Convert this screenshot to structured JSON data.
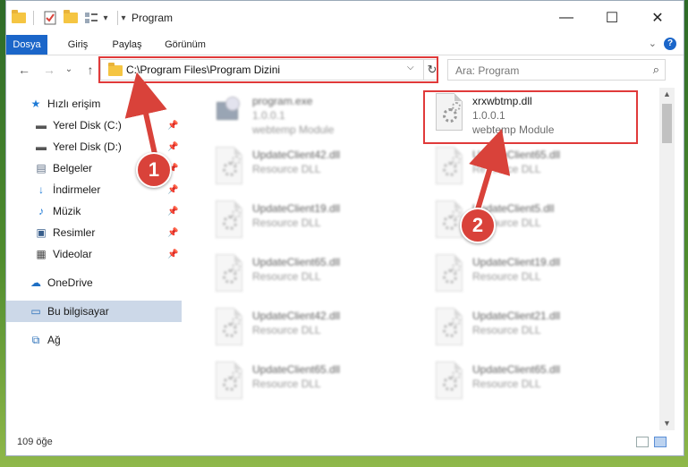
{
  "window": {
    "title": "Program",
    "controls": {
      "minimize": "—",
      "maximize": "☐",
      "close": "✕"
    }
  },
  "quick_access_toolbar": {
    "icons": [
      "folder-icon",
      "properties-checkmark-icon",
      "new-folder-icon",
      "view-options-icon",
      "dropdown-arrow-icon"
    ],
    "dropdown_glyph": "▾"
  },
  "ribbon": {
    "tabs": [
      {
        "label": "Dosya",
        "active": true
      },
      {
        "label": "Giriş"
      },
      {
        "label": "Paylaş"
      },
      {
        "label": "Görünüm"
      }
    ],
    "help": "?",
    "collapse": "⌄"
  },
  "navigation": {
    "back": "←",
    "forward": "→",
    "recent": "⌄",
    "up": "↑",
    "address": "C:\\Program Files\\Program Dizini",
    "address_dropdown": "⌵",
    "refresh": "↻",
    "search_placeholder": "Ara: Program",
    "search_icon": "⌕"
  },
  "sidebar": {
    "items": [
      {
        "label": "Hızlı erişim",
        "icon": "star-icon",
        "glyph": "★",
        "color": "#1e7ad6",
        "pinned": false
      },
      {
        "label": "Yerel Disk (C:)",
        "icon": "drive-icon",
        "glyph": "▬",
        "color": "#555555",
        "pinned": true
      },
      {
        "label": "Yerel Disk (D:)",
        "icon": "drive-icon",
        "glyph": "▬",
        "color": "#555555",
        "pinned": true
      },
      {
        "label": "Belgeler",
        "icon": "documents-icon",
        "glyph": "▤",
        "color": "#5a6b82",
        "pinned": true
      },
      {
        "label": "İndirmeler",
        "icon": "download-icon",
        "glyph": "↓",
        "color": "#1e7ad6",
        "pinned": true
      },
      {
        "label": "Müzik",
        "icon": "music-icon",
        "glyph": "♪",
        "color": "#1e7ad6",
        "pinned": true
      },
      {
        "label": "Resimler",
        "icon": "pictures-icon",
        "glyph": "▣",
        "color": "#3a5f8c",
        "pinned": true
      },
      {
        "label": "Videolar",
        "icon": "videos-icon",
        "glyph": "▦",
        "color": "#444444",
        "pinned": true
      },
      {
        "label": "OneDrive",
        "icon": "cloud-icon",
        "glyph": "☁",
        "color": "#1e6fc4",
        "pinned": false
      },
      {
        "label": "Bu bilgisayar",
        "icon": "computer-icon",
        "glyph": "▭",
        "color": "#2a6fb8",
        "pinned": false,
        "selected": true
      },
      {
        "label": "Ağ",
        "icon": "network-icon",
        "glyph": "⧉",
        "color": "#2a6fb8",
        "pinned": false
      }
    ],
    "pin_glyph": "📌"
  },
  "files": [
    {
      "name": "program.exe",
      "line2": "1.0.0.1",
      "line3": "webtemp Module",
      "icon": "exe-icon",
      "blurred": true
    },
    {
      "name": "xrxwbtmp.dll",
      "line2": "1.0.0.1",
      "line3": "webtemp Module",
      "icon": "dll-gear-icon",
      "blurred": false,
      "highlighted": true
    },
    {
      "name": "UpdateClient42.dll",
      "line2": "Resource DLL",
      "icon": "dll-gear-icon",
      "blurred": true
    },
    {
      "name": "UpdateClient65.dll",
      "line2": "Resource DLL",
      "icon": "dll-gear-icon",
      "blurred": true
    },
    {
      "name": "UpdateClient19.dll",
      "line2": "Resource DLL",
      "icon": "dll-gear-icon",
      "blurred": true
    },
    {
      "name": "UpdateClient5.dll",
      "line2": "Resource DLL",
      "icon": "dll-gear-icon",
      "blurred": true
    },
    {
      "name": "UpdateClient65.dll",
      "line2": "Resource DLL",
      "icon": "dll-gear-icon",
      "blurred": true
    },
    {
      "name": "UpdateClient19.dll",
      "line2": "Resource DLL",
      "icon": "dll-gear-icon",
      "blurred": true
    },
    {
      "name": "UpdateClient42.dll",
      "line2": "Resource DLL",
      "icon": "dll-gear-icon",
      "blurred": true
    },
    {
      "name": "UpdateClient21.dll",
      "line2": "Resource DLL",
      "icon": "dll-gear-icon",
      "blurred": true
    },
    {
      "name": "UpdateClient65.dll",
      "line2": "Resource DLL",
      "icon": "dll-gear-icon",
      "blurred": true
    },
    {
      "name": "UpdateClient65.dll",
      "line2": "Resource DLL",
      "icon": "dll-gear-icon",
      "blurred": true
    }
  ],
  "scrollbar": {
    "up": "▲",
    "down": "▼"
  },
  "status": {
    "item_count": "109 öğe"
  },
  "annotations": {
    "callout_1": "1",
    "callout_2": "2",
    "highlight_color": "#e03a3a"
  }
}
